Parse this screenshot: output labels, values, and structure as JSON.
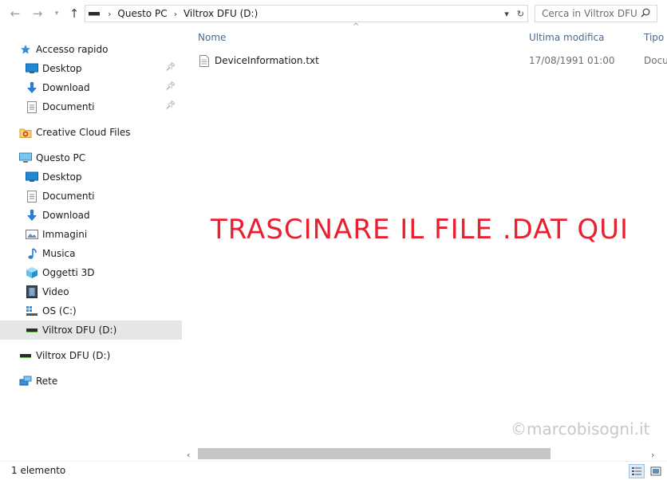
{
  "address_bar": {
    "breadcrumbs": [
      "Questo PC",
      "Viltrox DFU (D:)"
    ],
    "search_placeholder": "Cerca in Viltrox DFU ..."
  },
  "nav_pane": {
    "quick_access": {
      "label": "Accesso rapido",
      "items": [
        {
          "label": "Desktop",
          "icon": "desktop-icon",
          "pinned": true
        },
        {
          "label": "Download",
          "icon": "download-icon",
          "pinned": true
        },
        {
          "label": "Documenti",
          "icon": "documents-icon",
          "pinned": true
        }
      ]
    },
    "creative_cloud": {
      "label": "Creative Cloud Files",
      "icon": "creative-cloud-icon"
    },
    "this_pc": {
      "label": "Questo PC",
      "items": [
        {
          "label": "Desktop",
          "icon": "desktop-icon"
        },
        {
          "label": "Documenti",
          "icon": "documents-icon"
        },
        {
          "label": "Download",
          "icon": "download-icon"
        },
        {
          "label": "Immagini",
          "icon": "pictures-icon"
        },
        {
          "label": "Musica",
          "icon": "music-icon"
        },
        {
          "label": "Oggetti 3D",
          "icon": "objects-3d-icon"
        },
        {
          "label": "Video",
          "icon": "video-icon"
        },
        {
          "label": "OS (C:)",
          "icon": "os-drive-icon"
        },
        {
          "label": "Viltrox DFU (D:)",
          "icon": "usb-drive-icon",
          "selected": true
        }
      ]
    },
    "removable": {
      "label": "Viltrox DFU (D:)",
      "icon": "usb-drive-icon"
    },
    "network": {
      "label": "Rete",
      "icon": "network-icon"
    }
  },
  "columns": {
    "name": "Nome",
    "modified": "Ultima modifica",
    "type": "Tipo"
  },
  "files": [
    {
      "name": "DeviceInformation.txt",
      "modified": "17/08/1991 01:00",
      "type": "Docu"
    }
  ],
  "overlay_text": "TRASCINARE IL FILE .DAT QUI",
  "watermark": "©marcobisogni.it",
  "status": {
    "item_count": "1 elemento"
  },
  "colors": {
    "overlay": "#e8202f",
    "selection": "#e6e6e6",
    "column_header": "#4d6a8a",
    "watermark": "#c8c8c8"
  }
}
